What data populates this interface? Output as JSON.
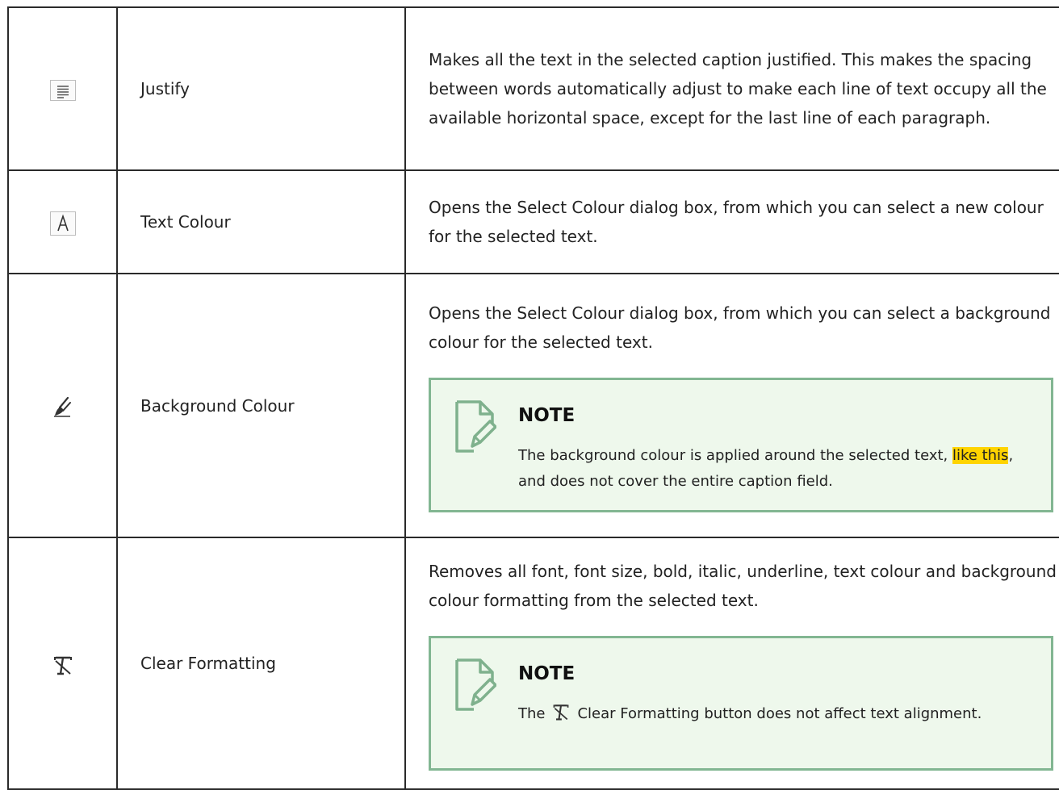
{
  "rows": [
    {
      "icon": "justify-icon",
      "name": "Justify",
      "description": "Makes all the text in the selected caption justified. This makes the spacing between words automatically adjust to make each line of text occupy all the available horizontal space, except for the last line of each paragraph."
    },
    {
      "icon": "text-colour-icon",
      "name": "Text Colour",
      "description": "Opens the Select Colour dialog box, from which you can select a new colour for the selected text."
    },
    {
      "icon": "background-colour-brush-icon",
      "name": "Background Colour",
      "description": "Opens the Select Colour dialog box, from which you can select a background colour for the selected text.",
      "note": {
        "title": "NOTE",
        "text_before": "The background colour is applied around the selected text, ",
        "highlight": "like this",
        "text_after": ", and does not cover the entire caption field."
      }
    },
    {
      "icon": "clear-formatting-icon",
      "name": "Clear Formatting",
      "description": "Removes all font, font size, bold, italic, underline, text colour and background colour formatting from the selected text.",
      "note": {
        "title": "NOTE",
        "text_before": "The",
        "inline_icon": "clear-formatting-icon",
        "text_after": "Clear Formatting button does not affect text alignment."
      }
    }
  ],
  "colors": {
    "note_border": "#82b692",
    "note_background": "#eef8ec",
    "highlight": "#ffd400",
    "note_icon": "#7fb18d"
  }
}
